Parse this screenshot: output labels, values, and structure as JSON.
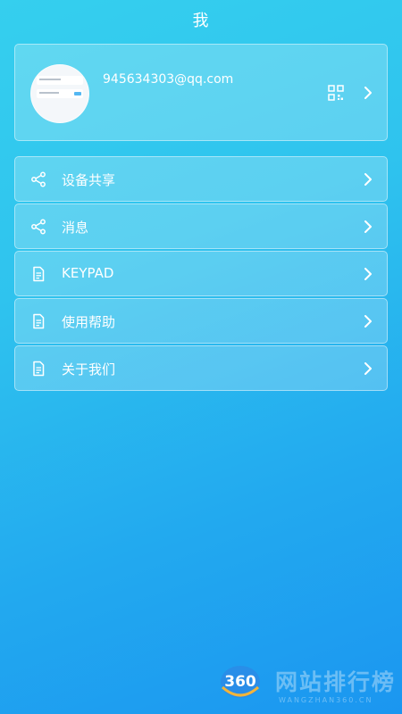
{
  "header": {
    "title": "我"
  },
  "profile": {
    "email": "945634303@qq.com",
    "qr_icon": "qr-code-icon",
    "chevron_icon": "chevron-right-icon"
  },
  "menu": {
    "items": [
      {
        "label": "设备共享",
        "icon": "share-icon"
      },
      {
        "label": "消息",
        "icon": "share-icon"
      },
      {
        "label": "KEYPAD",
        "icon": "document-icon"
      },
      {
        "label": "使用帮助",
        "icon": "document-icon"
      },
      {
        "label": "关于我们",
        "icon": "document-icon"
      }
    ]
  },
  "watermark": {
    "logo_text": "360",
    "text": "网站排行榜",
    "subtext": "WANGZHAN360.CN"
  },
  "colors": {
    "gradient_start": "#35cfee",
    "gradient_end": "#1b96f0",
    "text": "#ffffff"
  }
}
